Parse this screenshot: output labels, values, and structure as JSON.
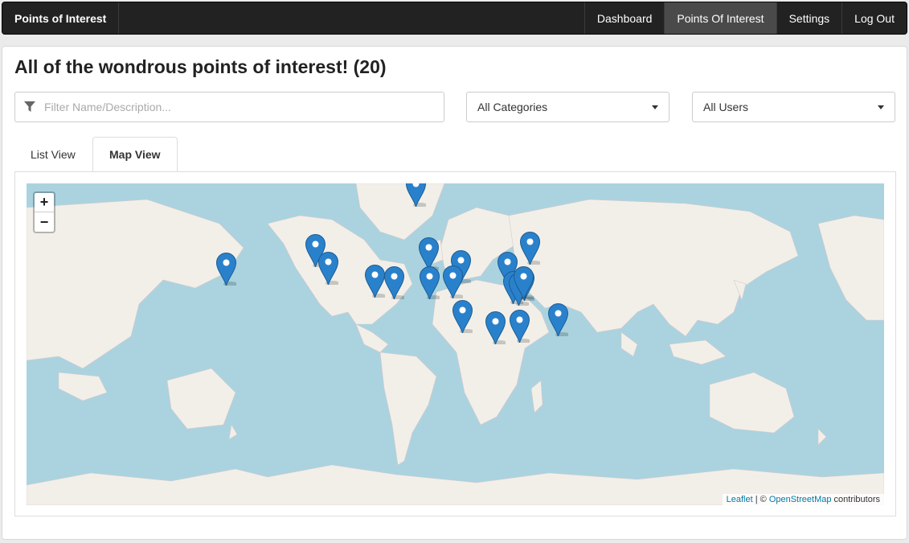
{
  "navbar": {
    "brand": "Points of Interest",
    "items": [
      {
        "label": "Dashboard",
        "active": false
      },
      {
        "label": "Points Of Interest",
        "active": true
      },
      {
        "label": "Settings",
        "active": false
      },
      {
        "label": "Log Out",
        "active": false
      }
    ]
  },
  "page": {
    "title": "All of the wondrous points of interest! (20)"
  },
  "filters": {
    "search_placeholder": "Filter Name/Description...",
    "search_value": "",
    "category_selected": "All Categories",
    "user_selected": "All Users"
  },
  "tabs": [
    {
      "label": "List View",
      "active": false
    },
    {
      "label": "Map View",
      "active": true
    }
  ],
  "map": {
    "zoom_in": "+",
    "zoom_out": "−",
    "attribution": {
      "leaflet": "Leaflet",
      "separator": " | © ",
      "osm": "OpenStreetMap",
      "suffix": " contributors"
    },
    "marker_count": 20,
    "colors": {
      "water": "#aad3df",
      "land": "#f2efe9",
      "marker": "#2a81cb"
    },
    "icons": {
      "filter": "filter-icon",
      "marker": "map-marker-icon"
    }
  }
}
